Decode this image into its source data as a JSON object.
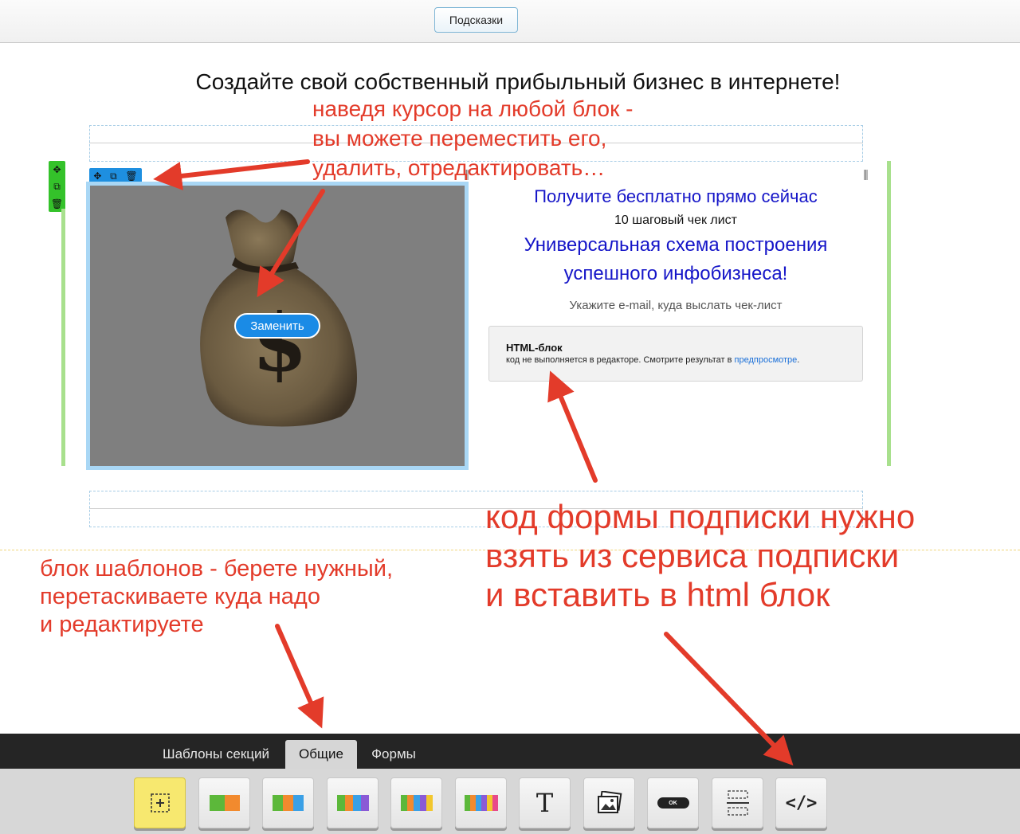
{
  "topbar": {
    "hints_label": "Подсказки"
  },
  "page": {
    "headline": "Создайте свой собственный прибыльный бизнес в интернете!",
    "image_block": {
      "replace_label": "Заменить"
    },
    "offer": {
      "title": "Получите бесплатно прямо сейчас",
      "subtitle": "10 шаговый чек лист",
      "main_line1": "Универсальная схема построения",
      "main_line2": "успешного инфобизнеса!",
      "email_prompt": "Укажите e-mail, куда выслать чек-лист"
    },
    "html_block": {
      "title": "HTML-блок",
      "desc": "код не выполняется в редакторе. Смотрите результат в ",
      "link": "предпросмотре",
      "period": "."
    }
  },
  "annotations": {
    "note1": [
      "наведя курсор на любой блок -",
      "вы можете переместить его,",
      "удалить, отредактировать…"
    ],
    "note2": [
      "блок шаблонов - берете нужный,",
      "перетаскиваете куда надо",
      "и редактируете"
    ],
    "note3": [
      "код формы подписки нужно",
      "взять из сервиса подписки",
      "и вставить в html блок"
    ],
    "color": "#e33b2a"
  },
  "bottom": {
    "tabs": [
      {
        "label": "Шаблоны секций",
        "active": false
      },
      {
        "label": "Общие",
        "active": true
      },
      {
        "label": "Формы",
        "active": false
      }
    ],
    "tools": [
      {
        "name": "add-section",
        "glyph": "+"
      },
      {
        "name": "two-columns"
      },
      {
        "name": "three-columns"
      },
      {
        "name": "four-columns"
      },
      {
        "name": "five-columns"
      },
      {
        "name": "six-columns"
      },
      {
        "name": "text",
        "glyph": "T"
      },
      {
        "name": "image"
      },
      {
        "name": "button",
        "glyph": "OK"
      },
      {
        "name": "divider"
      },
      {
        "name": "html-code",
        "glyph": "</>"
      }
    ]
  },
  "colors": {
    "accent_blue": "#1a8be6",
    "offer_blue": "#1515c8",
    "rail_green": "#a8e08d",
    "toolbar_green": "#34c22a",
    "annotation_red": "#e33b2a"
  }
}
